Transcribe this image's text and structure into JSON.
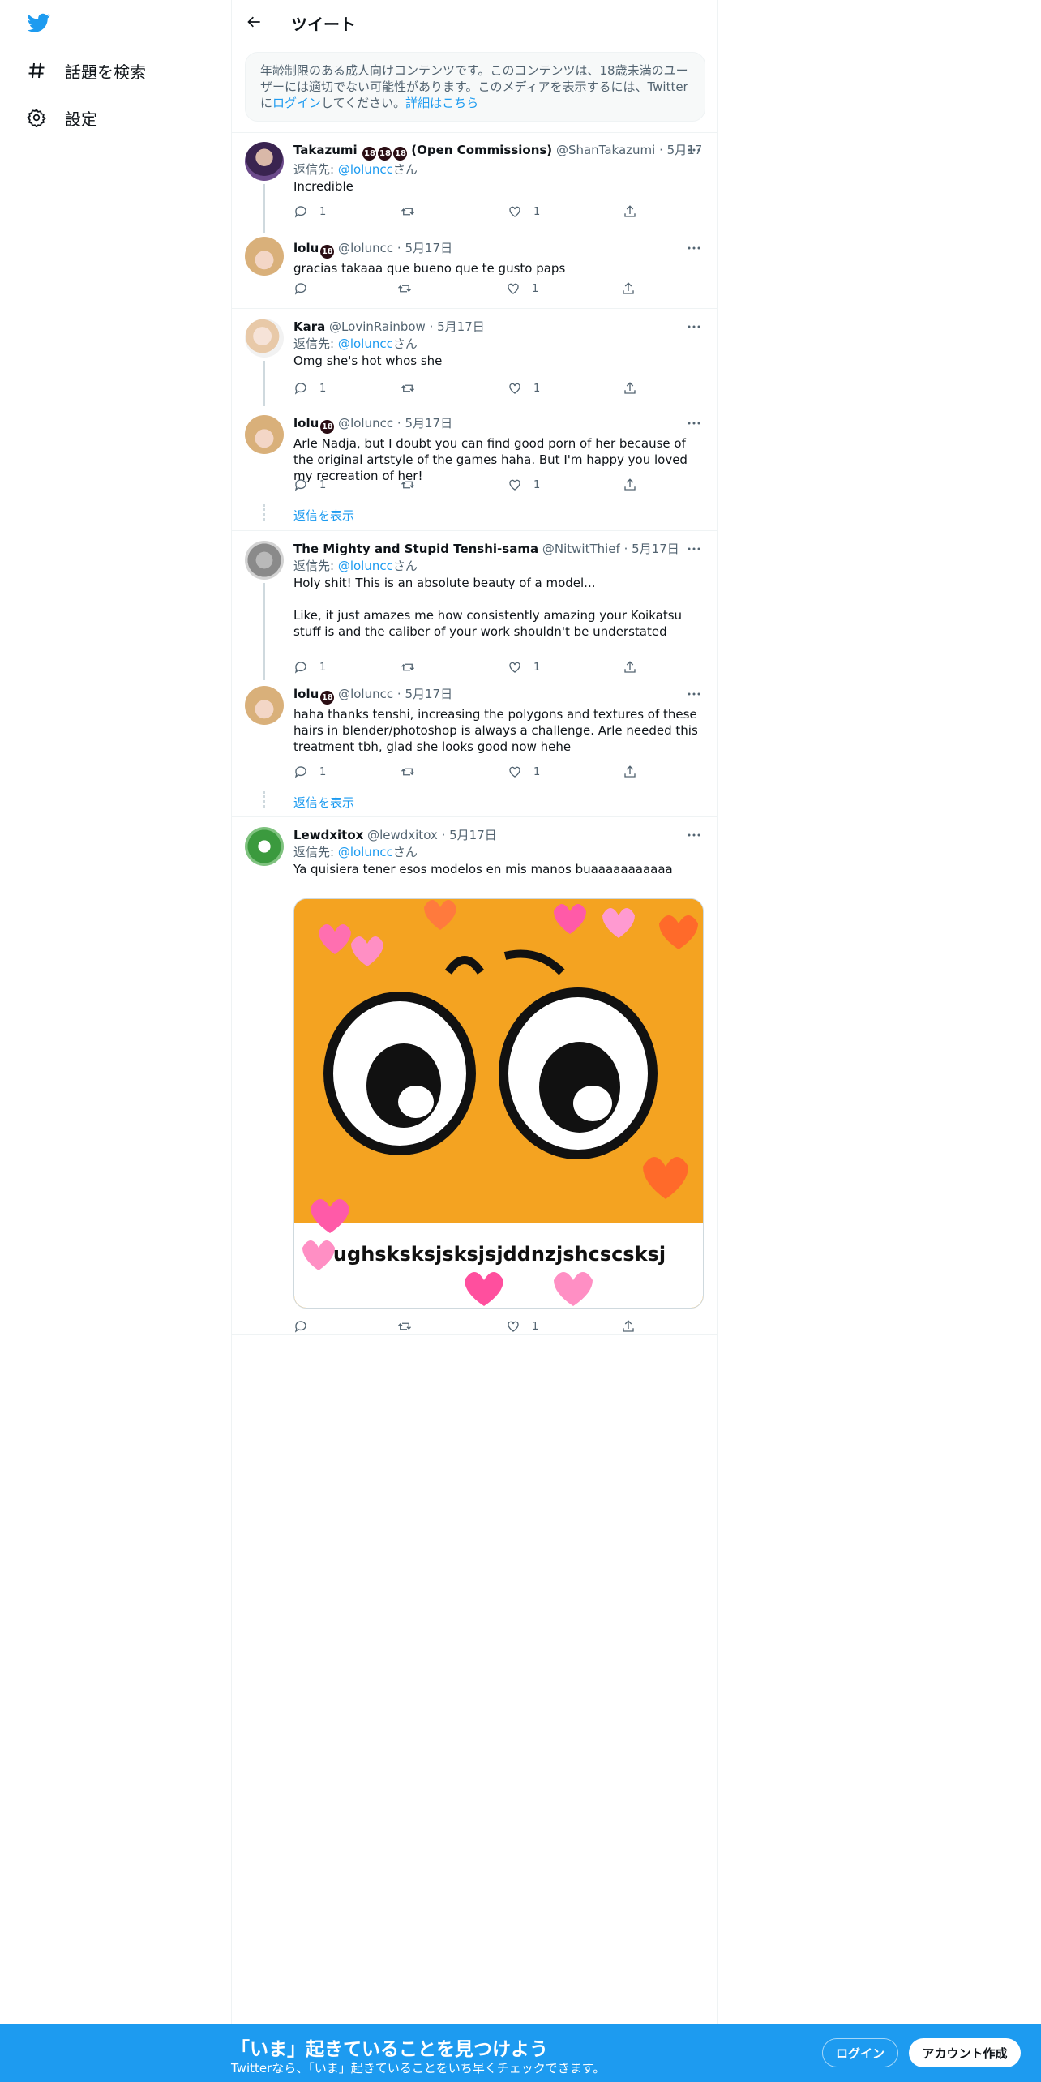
{
  "colors": {
    "accent": "#1d9bf0",
    "text": "#0f1419",
    "secondary": "#536471",
    "border": "#eff3f4"
  },
  "sidebar": {
    "logo": "twitter-bird-icon",
    "items": [
      {
        "label": "話題を検索",
        "icon": "hashtag-icon"
      },
      {
        "label": "設定",
        "icon": "gear-icon"
      }
    ]
  },
  "header": {
    "title": "ツイート",
    "back_icon": "arrow-left-icon"
  },
  "notice": {
    "text_1": "年齢制限のある成人向けコンテンツです。このコンテンツは、18歳未満のユーザーには適切でない可能性があります。このメディアを表示するには、Twitterに",
    "login_link": "ログイン",
    "text_2": "してください。",
    "details_link": "詳細はこちら"
  },
  "reply_prefix": "返信先: ",
  "reply_suffix": "さん",
  "badge": "18",
  "show_replies": "返信を表示",
  "tweets": [
    {
      "name": "Takazumi",
      "name_suffix": "(Open Commissions)",
      "handle": "@ShanTakazumi",
      "date": "5月17日",
      "reply_to": "@loluncc",
      "text": "Incredible",
      "replies": "1",
      "retweets": "",
      "likes": "1"
    },
    {
      "name": "lolu",
      "handle": "@loluncc",
      "date": "5月17日",
      "text": "gracias takaaa que bueno que te gusto paps",
      "replies": "",
      "retweets": "",
      "likes": "1"
    },
    {
      "name": "Kara",
      "handle": "@LovinRainbow",
      "date": "5月17日",
      "reply_to": "@loluncc",
      "text": "Omg she's hot whos she",
      "replies": "1",
      "retweets": "",
      "likes": "1"
    },
    {
      "name": "lolu",
      "handle": "@loluncc",
      "date": "5月17日",
      "text": "Arle Nadja, but I doubt you can find good porn of her because of the original artstyle of the games haha. But I'm happy you loved my recreation of her!",
      "replies": "1",
      "retweets": "",
      "likes": "1"
    },
    {
      "name": "The Mighty and Stupid Tenshi-sama",
      "handle": "@NitwitThief",
      "date": "5月17日",
      "reply_to": "@loluncc",
      "text": "Holy shit! This is an absolute beauty of a model...",
      "text_2": "Like, it just amazes me how consistently amazing your Koikatsu stuff is and the caliber of your work shouldn't be understated",
      "replies": "1",
      "retweets": "",
      "likes": "1"
    },
    {
      "name": "lolu",
      "handle": "@loluncc",
      "date": "5月17日",
      "text": "haha thanks tenshi, increasing the polygons and textures of these hairs in blender/photoshop is always a challenge. Arle needed this treatment tbh, glad she looks good now hehe",
      "replies": "1",
      "retweets": "",
      "likes": "1"
    },
    {
      "name": "Lewdxitox",
      "handle": "@lewdxitox",
      "date": "5月17日",
      "reply_to": "@loluncc",
      "text": "Ya quisiera tener esos modelos en mis manos buaaaaaaaaaaa",
      "media_caption": "ughsksksjsksjsjddnzjshcscsksj",
      "replies": "",
      "retweets": "",
      "likes": "1"
    }
  ],
  "bottom_bar": {
    "title": "「いま」起きていることを見つけよう",
    "subtitle": "Twitterなら、「いま」起きていることをいち早くチェックできます。",
    "login": "ログイン",
    "signup": "アカウント作成"
  }
}
